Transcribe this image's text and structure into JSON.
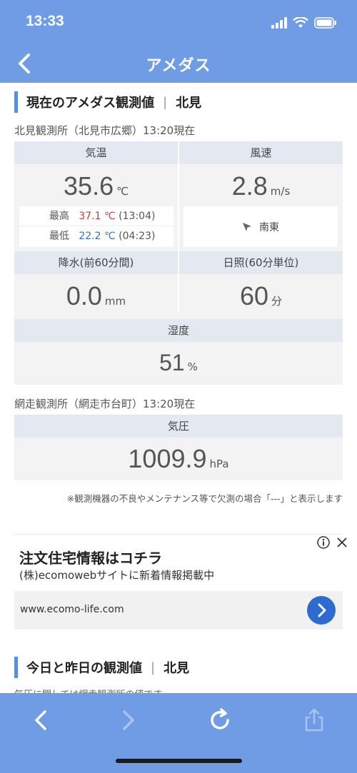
{
  "status_bar": {
    "time": "13:33"
  },
  "nav": {
    "title": "アメダス"
  },
  "current": {
    "section_title": "現在のアメダス観測値",
    "location": "北見",
    "station1_label": "北見観測所（北見市広郷）13:20現在",
    "temperature": {
      "header": "気温",
      "value": "35.6",
      "unit": "℃",
      "max_label": "最高",
      "max_value": "37.1 ℃",
      "max_time": "(13:04)",
      "min_label": "最低",
      "min_value": "22.2 ℃",
      "min_time": "(04:23)"
    },
    "wind": {
      "header": "風速",
      "value": "2.8",
      "unit": "m/s",
      "direction": "南東"
    },
    "precip": {
      "header": "降水(前60分間)",
      "value": "0.0",
      "unit": "mm"
    },
    "sunshine": {
      "header": "日照(60分単位)",
      "value": "60",
      "unit": "分"
    },
    "humidity": {
      "header": "湿度",
      "value": "51",
      "unit": "%"
    },
    "station2_label": "網走観測所（網走市台町）13:20現在",
    "pressure": {
      "header": "気圧",
      "value": "1009.9",
      "unit": "hPa"
    },
    "note": "※観測機器の不良やメンテナンス等で欠測の場合「---」と表示します"
  },
  "ad": {
    "title": "注文住宅情報はコチラ",
    "subtitle": "(株)ecomowebサイトに新着情報掲載中",
    "url": "www.ecomo-life.com"
  },
  "history": {
    "section_title": "今日と昨日の観測値",
    "location": "北見",
    "note": "気圧に関しては網走観測所の値です"
  },
  "colors": {
    "accent": "#6f9ce4",
    "max_temp": "#d23b3b",
    "min_temp": "#3b6fc4",
    "ad_button": "#2e6bd1"
  }
}
